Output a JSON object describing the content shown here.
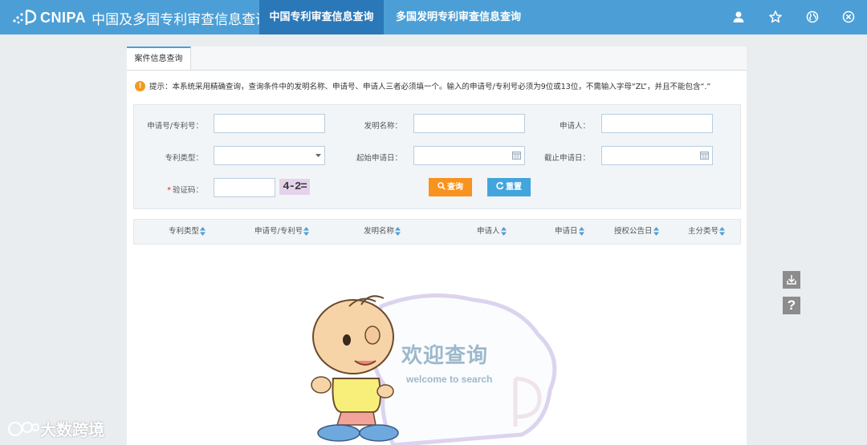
{
  "header": {
    "brand": "CNIPA",
    "brand_cn": "中国及多国专利审查信息查询",
    "tabs": [
      {
        "label": "中国专利审查信息查询",
        "active": true
      },
      {
        "label": "多国发明专利审查信息查询",
        "active": false
      }
    ],
    "icons": [
      "user-icon",
      "star-icon",
      "globe-icon",
      "close-icon"
    ]
  },
  "tab": {
    "label": "案件信息查询"
  },
  "notice": "提示：本系统采用精确查询，查询条件中的发明名称、申请号、申请人三者必须填一个。输入的申请号/专利号必须为9位或13位，不需输入字母“ZL”，并且不能包含“.”",
  "form": {
    "app_no_label": "申请号/专利号：",
    "title_label": "发明名称：",
    "applicant_label": "申请人：",
    "type_label": "专利类型：",
    "start_date_label": "起始申请日：",
    "end_date_label": "截止申请日：",
    "captcha_label": "验证码：",
    "captcha_text": "4-2=",
    "search_button": "查询",
    "reset_button": "重置"
  },
  "table": {
    "columns": [
      "专利类型",
      "申请号/专利号",
      "发明名称",
      "申请人",
      "申请日",
      "授权公告日",
      "主分类号"
    ]
  },
  "welcome": {
    "title": "欢迎查询",
    "subtitle": "welcome to search"
  },
  "watermark": "大数跨境",
  "colors": {
    "header": "#4c9fd6",
    "header_active": "#2b78b8",
    "search_button": "#f7931e",
    "reset_button": "#42a5dc",
    "warning": "#f39a1e"
  }
}
